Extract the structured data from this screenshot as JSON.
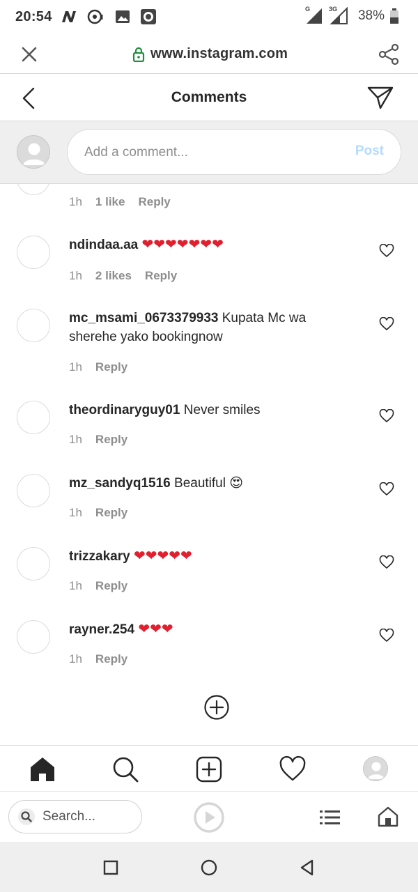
{
  "status_bar": {
    "time": "20:54",
    "network_1": "G",
    "network_2": "3G",
    "battery": "38%"
  },
  "browser": {
    "url": "www.instagram.com",
    "search_placeholder": "Search...",
    "icons": [
      "close-icon",
      "lock-icon",
      "share-icon",
      "search-icon",
      "play-icon",
      "tabs-list-icon",
      "browser-home-icon"
    ]
  },
  "header": {
    "title": "Comments"
  },
  "add_comment": {
    "placeholder": "Add a comment...",
    "post_label": "Post",
    "post_color": "#b3dbff"
  },
  "partial_comment": {
    "time": "1h",
    "likes": "1 like",
    "reply": "Reply"
  },
  "comments": [
    {
      "username": "ndindaa.aa",
      "text": "❤❤❤❤❤❤❤",
      "time": "1h",
      "likes": "2 likes",
      "reply": "Reply"
    },
    {
      "username": "mc_msami_0673379933",
      "text": "Kupata Mc wa sherehe yako bookingnow",
      "time": "1h",
      "reply": "Reply"
    },
    {
      "username": "theordinaryguy01",
      "text": "Never smiles",
      "time": "1h",
      "reply": "Reply"
    },
    {
      "username": "mz_sandyq1516",
      "text": "Beautiful 😍",
      "time": "1h",
      "reply": "Reply"
    },
    {
      "username": "trizzakary",
      "text": "❤❤❤❤❤",
      "time": "1h",
      "reply": "Reply"
    },
    {
      "username": "rayner.254",
      "text": "❤❤❤",
      "time": "1h",
      "reply": "Reply"
    }
  ],
  "colors": {
    "heart_red": "#e0202e",
    "secondary_text": "#8e8e8e",
    "lock_green": "#1e8e3e"
  }
}
